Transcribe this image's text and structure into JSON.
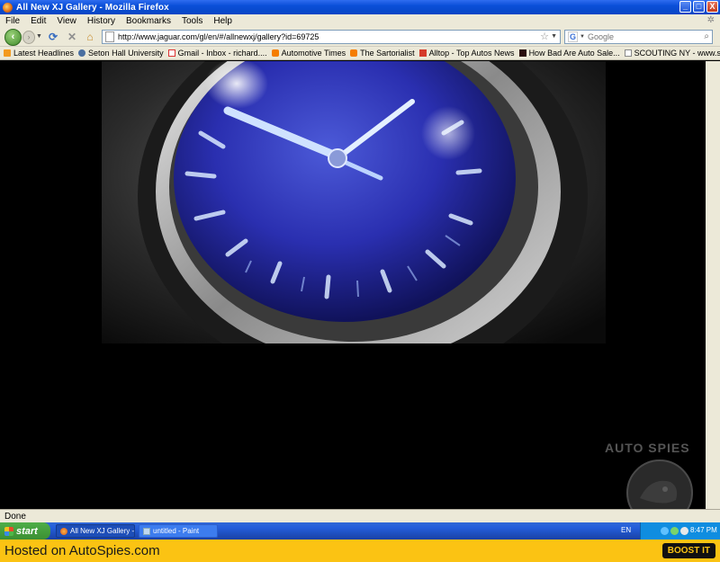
{
  "window": {
    "title": "All New XJ Gallery - Mozilla Firefox",
    "minimize": "_",
    "maximize": "□",
    "close": "X"
  },
  "menu": {
    "items": [
      "File",
      "Edit",
      "View",
      "History",
      "Bookmarks",
      "Tools",
      "Help"
    ]
  },
  "nav": {
    "url": "http://www.jaguar.com/gl/en/#/allnewxj/gallery?id=69725",
    "search_placeholder": "Google",
    "search_engine_icon": "G"
  },
  "bookmarks": [
    {
      "label": "Latest Headlines",
      "icon": "rss-icon"
    },
    {
      "label": "Seton Hall University",
      "icon": "university-icon"
    },
    {
      "label": "Gmail - Inbox - richard....",
      "icon": "gmail-icon"
    },
    {
      "label": "Automotive Times",
      "icon": "blogger-icon"
    },
    {
      "label": "The Sartorialist",
      "icon": "blogger-icon"
    },
    {
      "label": "Alltop - Top Autos News",
      "icon": "alltop-icon"
    },
    {
      "label": "How Bad Are Auto Sale...",
      "icon": "site-icon"
    },
    {
      "label": "SCOUTING NY - www.s...",
      "icon": "page-icon"
    }
  ],
  "content": {
    "watermark": "AUTO SPIES"
  },
  "status": {
    "text": "Done"
  },
  "taskbar": {
    "start_label": "start",
    "tasks": [
      {
        "label": "All New XJ Gallery - M..."
      },
      {
        "label": "untitled - Paint"
      }
    ],
    "language": "EN",
    "clock": "8:47 PM"
  },
  "footer": {
    "hosted_text": "Hosted on AutoSpies.com",
    "boost_label": "BOOST IT"
  },
  "colors": {
    "titlebar": "#0a4fd8",
    "chrome": "#ece9d8",
    "footer": "#fbc313",
    "clock_face": "#2a2fb0"
  }
}
